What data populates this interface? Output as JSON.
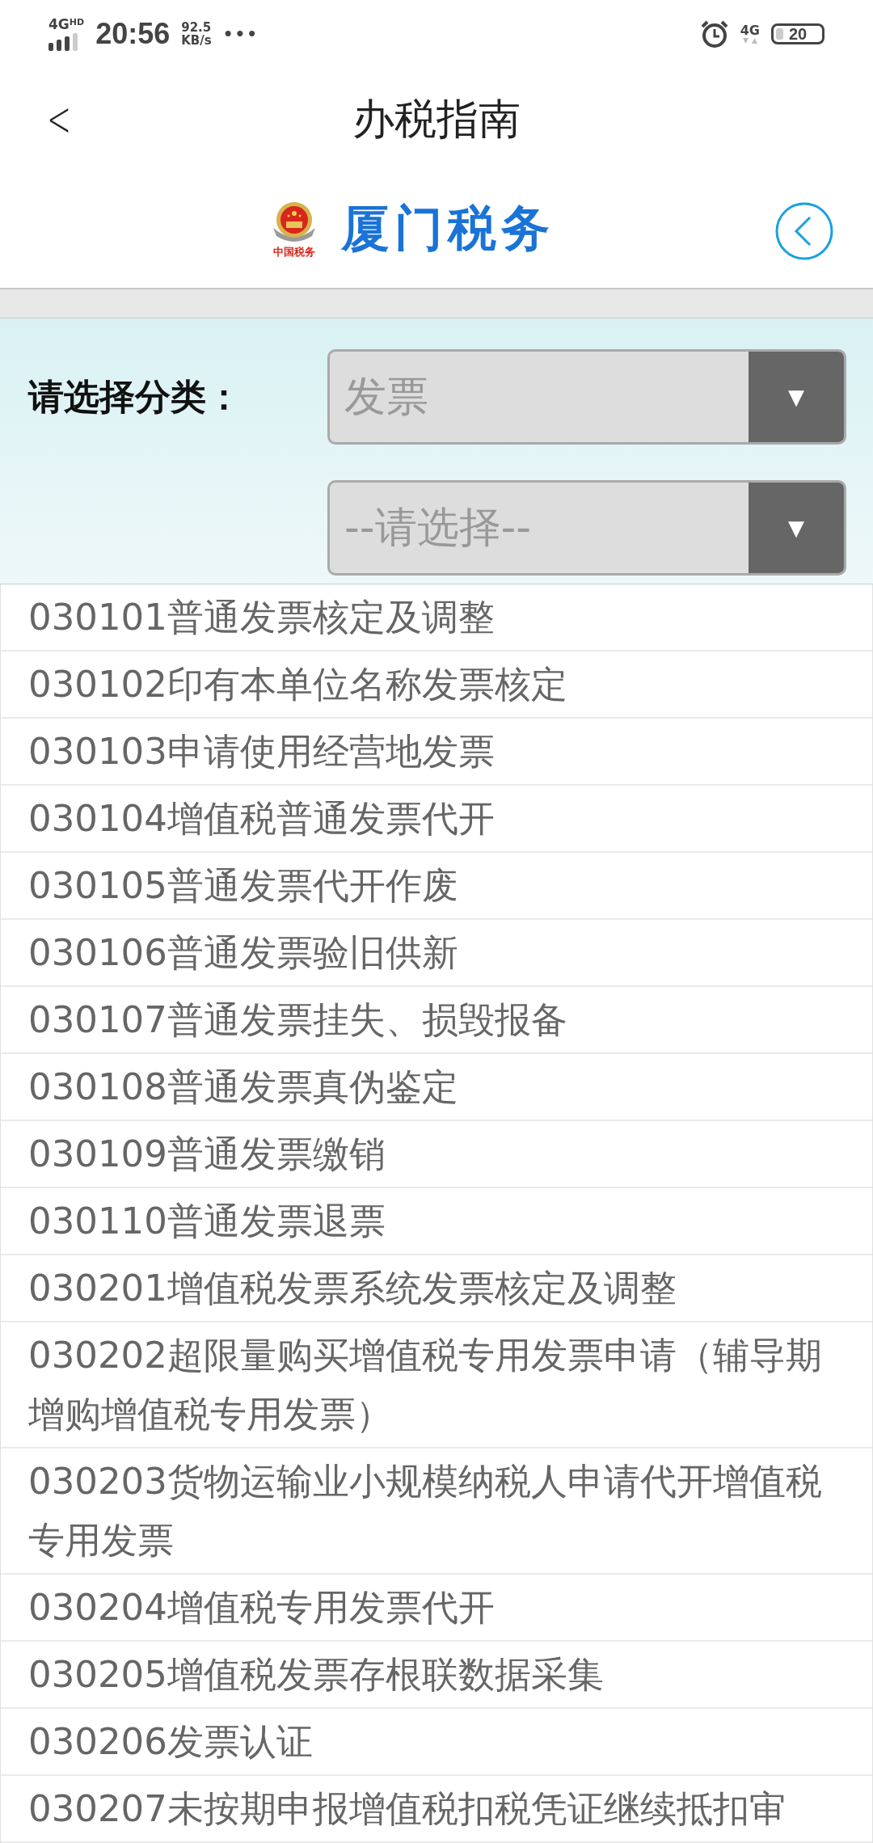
{
  "status_bar": {
    "network": "4G",
    "network_badge": "HD",
    "time": "20:56",
    "speed_value": "92.5",
    "speed_unit": "KB/s",
    "more": "•••",
    "data_type": "4G",
    "battery": "20"
  },
  "nav": {
    "back": "<",
    "title": "办税指南"
  },
  "brand": {
    "emblem_text": "中国税务",
    "name": "厦门税务"
  },
  "filter": {
    "label": "请选择分类：",
    "selects": [
      {
        "value": "发票",
        "arrow": "▼"
      },
      {
        "value": "--请选择--",
        "arrow": "▼"
      }
    ]
  },
  "items": [
    {
      "text": "030101普通发票核定及调整"
    },
    {
      "text": "030102印有本单位名称发票核定"
    },
    {
      "text": "030103申请使用经营地发票"
    },
    {
      "text": "030104增值税普通发票代开"
    },
    {
      "text": "030105普通发票代开作废"
    },
    {
      "text": "030106普通发票验旧供新"
    },
    {
      "text": "030107普通发票挂失、损毁报备"
    },
    {
      "text": "030108普通发票真伪鉴定"
    },
    {
      "text": "030109普通发票缴销"
    },
    {
      "text": "030110普通发票退票"
    },
    {
      "text": "030201增值税发票系统发票核定及调整"
    },
    {
      "text": "030202超限量购买增值税专用发票申请（辅导期增购增值税专用发票）"
    },
    {
      "text": "030203货物运输业小规模纳税人申请代开增值税专用发票"
    },
    {
      "text": "030204增值税专用发票代开"
    },
    {
      "text": "030205增值税发票存根联数据采集"
    },
    {
      "text": "030206发票认证"
    },
    {
      "text": "030207未按期申报增值税扣税凭证继续抵扣审"
    }
  ]
}
